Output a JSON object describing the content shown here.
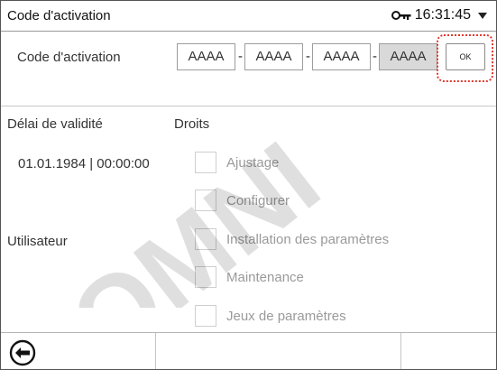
{
  "header": {
    "title": "Code d'activation",
    "time": "16:31:45"
  },
  "activation": {
    "label": "Code d'activation",
    "fields": [
      "AAAA",
      "AAAA",
      "AAAA",
      "AAAA"
    ],
    "separator": "-",
    "ok_label": "OK"
  },
  "validity": {
    "label": "Délai de validité",
    "value": "01.01.1984 | 00:00:00"
  },
  "user": {
    "label": "Utilisateur"
  },
  "rights": {
    "title": "Droits",
    "items": [
      {
        "label": "Ajustage",
        "checked": false
      },
      {
        "label": "Configurer",
        "checked": false
      },
      {
        "label": "Installation des paramètres",
        "checked": false
      },
      {
        "label": "Maintenance",
        "checked": false
      },
      {
        "label": "Jeux de paramètres",
        "checked": false
      }
    ]
  },
  "watermark": {
    "text": "OMNI"
  },
  "icons": {
    "key": "key-icon",
    "dropdown": "chevron-down-icon",
    "back": "back-arrow-icon"
  },
  "colors": {
    "highlight": "#e0392d",
    "disabled_text": "#9a9a9a",
    "filled_field": "#d9d9d9"
  }
}
